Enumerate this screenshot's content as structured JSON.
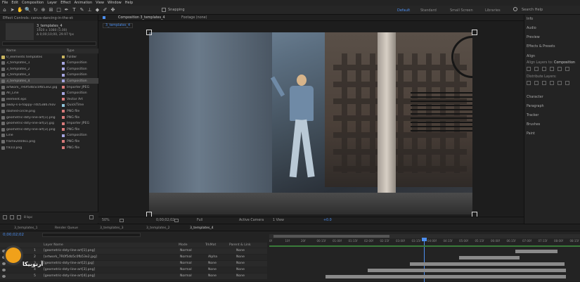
{
  "menu": [
    "File",
    "Edit",
    "Composition",
    "Layer",
    "Effect",
    "Animation",
    "View",
    "Window",
    "Help"
  ],
  "toolbar": {
    "snapping_label": "Snapping",
    "workspaces": [
      "Default",
      "Standard",
      "Small Screen",
      "Libraries"
    ],
    "search_placeholder": "Search Help"
  },
  "project": {
    "tabs": [
      "Effect Controls: canva-dancing-in-the-street-video",
      "Project"
    ],
    "selected_name": "3_templates_4",
    "selected_info": "1920 x 1080 (1.00)",
    "selected_duration": "Δ 0;00;10;00, 29.97 fps",
    "columns": [
      "Name",
      "Type"
    ],
    "items": [
      {
        "name": "0_elements templates",
        "type": "Folder",
        "label": "#c9b560"
      },
      {
        "name": "3_templates_1",
        "type": "Composition",
        "label": "#a5a5e0"
      },
      {
        "name": "3_templates_2",
        "type": "Composition",
        "label": "#a5a5e0"
      },
      {
        "name": "3_templates_3",
        "type": "Composition",
        "label": "#a5a5e0"
      },
      {
        "name": "3_templates_4",
        "type": "Composition",
        "label": "#a5a5e0"
      },
      {
        "name": "artwork_7R0f5db5c0fb53e2.jpg",
        "type": "Importer JPEG",
        "label": "#d77a7a"
      },
      {
        "name": "All_Line",
        "type": "Composition",
        "label": "#a5a5e0"
      },
      {
        "name": "element.eps",
        "type": "Vector Art",
        "label": "#d77a7a"
      },
      {
        "name": "away-s-a-happy-7405386.mov",
        "type": "QuickTime",
        "label": "#8fc4d9"
      },
      {
        "name": "dashed-circle.png",
        "type": "PNG file",
        "label": "#d77a7a"
      },
      {
        "name": "geometric-dsty-line-art[1].png",
        "type": "PNG file",
        "label": "#d77a7a"
      },
      {
        "name": "geometric-dsty-line-art[2].jpg",
        "type": "Importer JPEG",
        "label": "#d77a7a"
      },
      {
        "name": "geometric-dsty-line-art[3].png",
        "type": "PNG file",
        "label": "#d77a7a"
      },
      {
        "name": "Line",
        "type": "Composition",
        "label": "#a5a5e0"
      },
      {
        "name": "frame2004k1.png",
        "type": "PNG file",
        "label": "#d77a7a"
      },
      {
        "name": "frk10.png",
        "type": "PNG file",
        "label": "#d77a7a"
      }
    ],
    "bpc": "8 bpc"
  },
  "viewer": {
    "tabs": [
      "Composition 3_templates_4",
      "Footage (none)"
    ],
    "breadcrumb": "3_templates_4",
    "zoom": "50%",
    "timecode": "0;00;02;02",
    "resolution": "Full",
    "camera": "Active Camera",
    "views": "1 View",
    "exposure": "+0.0"
  },
  "panels": [
    "Info",
    "Audio",
    "Preview",
    "Effects & Presets",
    "Align",
    "Align Layers to:",
    "Composition",
    "Distribute Layers:",
    "Character",
    "Paragraph",
    "Tracker",
    "Brushes",
    "Paint"
  ],
  "timeline": {
    "tabs": [
      "3_templates_1",
      "Render Queue",
      "3_templates_3",
      "3_templates_2",
      "3_templates_4"
    ],
    "timecode": "0;00;02;02",
    "columns": [
      "Layer Name",
      "Mode",
      "TrkMat",
      "Parent & Link"
    ],
    "layers": [
      {
        "num": "1",
        "name": "[geometric-dsty-line-art[1].png]",
        "mode": "Normal",
        "trkmat": "",
        "parent": "None"
      },
      {
        "num": "2",
        "name": "[artwork_7R0f5db5c0fb53e2.jpg]",
        "mode": "Normal",
        "trkmat": "Alpha",
        "parent": "None"
      },
      {
        "num": "3",
        "name": "[geometric-dsty-line-art[2].jpg]",
        "mode": "Normal",
        "trkmat": "None",
        "parent": "None"
      },
      {
        "num": "4",
        "name": "[geometric-dsty-line-art[3].png]",
        "mode": "Normal",
        "trkmat": "None",
        "parent": "None"
      },
      {
        "num": "5",
        "name": "[geometric-dsty-line-art[4].png]",
        "mode": "Normal",
        "trkmat": "None",
        "parent": "None"
      }
    ],
    "ruler": [
      "0f",
      "10f",
      "20f",
      "00:15f",
      "01:00f",
      "01:15f",
      "02:00f",
      "02:15f",
      "03:00f",
      "03:15f",
      "04:00f",
      "04:15f",
      "05:00f",
      "05:15f",
      "06:00f",
      "06:15f",
      "07:00f",
      "07:15f",
      "08:00f",
      "08:15f"
    ]
  },
  "watermark": "آرنوبیکا",
  "colors": {
    "accent": "#4d8ff0",
    "panel": "#232323",
    "bg": "#1d1d1d",
    "layer_bar": "#8a8a8a"
  }
}
